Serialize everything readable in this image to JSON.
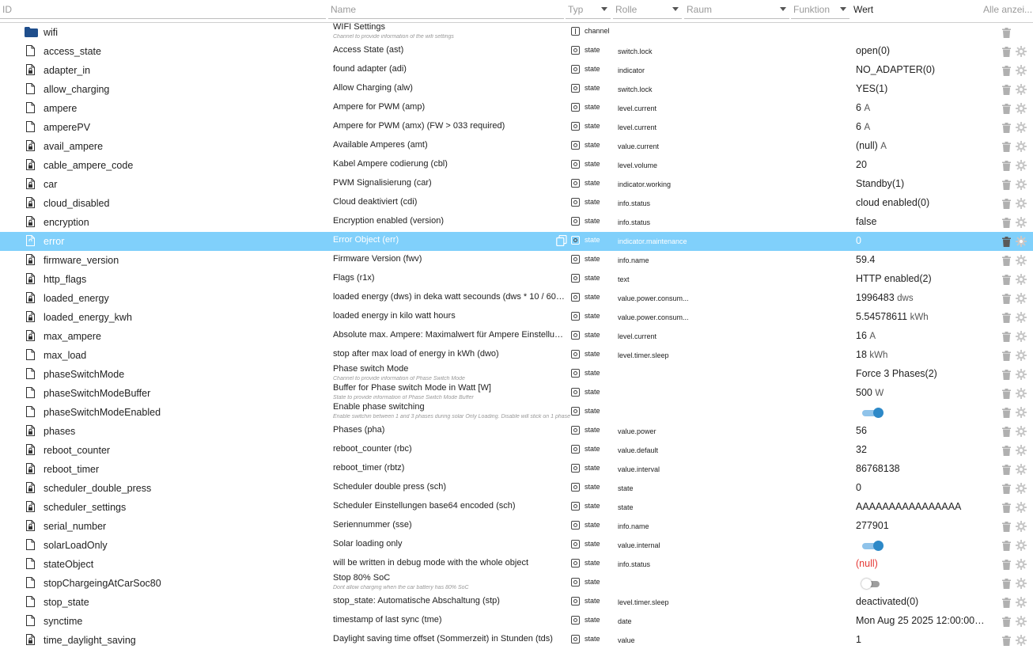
{
  "header": {
    "id": "ID",
    "name": "Name",
    "typ": "Typ",
    "rolle": "Rolle",
    "raum": "Raum",
    "funktion": "Funktion",
    "wert": "Wert",
    "alle": "Alle anzei..."
  },
  "rows": [
    {
      "id": "wifi",
      "kind": "folder",
      "name": "WIFI Settings",
      "desc": "Channel to provide information of the wifi settings",
      "type": "channel",
      "role": "",
      "value": ""
    },
    {
      "id": "access_state",
      "kind": "file",
      "name": "Access State (ast)",
      "type": "state",
      "role": "switch.lock",
      "value": "open(0)"
    },
    {
      "id": "adapter_in",
      "kind": "file-lock",
      "name": "found adapter (adi)",
      "type": "state",
      "role": "indicator",
      "value": "NO_ADAPTER(0)"
    },
    {
      "id": "allow_charging",
      "kind": "file",
      "name": "Allow Charging (alw)",
      "type": "state",
      "role": "switch.lock",
      "value": "YES(1)"
    },
    {
      "id": "ampere",
      "kind": "file",
      "name": "Ampere for PWM (amp)",
      "type": "state",
      "role": "level.current",
      "value": "6",
      "unit": "A"
    },
    {
      "id": "amperePV",
      "kind": "file",
      "name": "Ampere for PWM (amx) (FW > 033 required)",
      "type": "state",
      "role": "level.current",
      "value": "6",
      "unit": "A"
    },
    {
      "id": "avail_ampere",
      "kind": "file-lock",
      "name": "Available Amperes (amt)",
      "type": "state",
      "role": "value.current",
      "value": "(null)",
      "unit": "A"
    },
    {
      "id": "cable_ampere_code",
      "kind": "file-lock",
      "name": "Kabel Ampere codierung (cbl)",
      "type": "state",
      "role": "level.volume",
      "value": "20"
    },
    {
      "id": "car",
      "kind": "file-lock",
      "name": "PWM Signalisierung (car)",
      "type": "state",
      "role": "indicator.working",
      "value": "Standby(1)"
    },
    {
      "id": "cloud_disabled",
      "kind": "file-lock",
      "name": "Cloud deaktiviert (cdi)",
      "type": "state",
      "role": "info.status",
      "value": "cloud enabled(0)"
    },
    {
      "id": "encryption",
      "kind": "file-lock",
      "name": "Encryption enabled (version)",
      "type": "state",
      "role": "info.status",
      "value": "false"
    },
    {
      "id": "error",
      "kind": "file-lock",
      "name": "Error Object (err)",
      "type": "state",
      "role": "indicator.maintenance",
      "value": "0",
      "selected": true
    },
    {
      "id": "firmware_version",
      "kind": "file-lock",
      "name": "Firmware Version (fwv)",
      "type": "state",
      "role": "info.name",
      "value": "59.4"
    },
    {
      "id": "http_flags",
      "kind": "file-lock",
      "name": "Flags (r1x)",
      "type": "state",
      "role": "text",
      "value": "HTTP enabled(2)"
    },
    {
      "id": "loaded_energy",
      "kind": "file-lock",
      "name": "loaded energy (dws) in deka watt secounds (dws * 10 / 60 / 60 ...",
      "type": "state",
      "role": "value.power.consum...",
      "value": "1996483",
      "unit": "dws"
    },
    {
      "id": "loaded_energy_kwh",
      "kind": "file-lock",
      "name": "loaded energy in kilo watt hours",
      "type": "state",
      "role": "value.power.consum...",
      "value": "5.54578611",
      "unit": "kWh"
    },
    {
      "id": "max_ampere",
      "kind": "file-lock",
      "name": "Absolute max. Ampere: Maximalwert für Ampere Einstellung (a...",
      "type": "state",
      "role": "level.current",
      "value": "16",
      "unit": "A"
    },
    {
      "id": "max_load",
      "kind": "file",
      "name": "stop after max load of energy in kWh (dwo)",
      "type": "state",
      "role": "level.timer.sleep",
      "value": "18",
      "unit": "kWh"
    },
    {
      "id": "phaseSwitchMode",
      "kind": "file",
      "name": "Phase switch Mode",
      "desc": "Channel to provide information of Phase Switch Mode",
      "type": "state",
      "role": "",
      "value": "Force 3 Phases(2)"
    },
    {
      "id": "phaseSwitchModeBuffer",
      "kind": "file",
      "name": "Buffer for Phase switch Mode in Watt [W]",
      "desc": "State to provide information of Phase Switch Mode Buffer",
      "type": "state",
      "role": "",
      "value": "500",
      "unit": "W"
    },
    {
      "id": "phaseSwitchModeEnabled",
      "kind": "file",
      "name": "Enable phase switching",
      "desc": "Enable switchin between 1 and 3 phases during solar Only Loading. Disable will stick on 1 phase",
      "type": "state",
      "role": "",
      "toggle": "on"
    },
    {
      "id": "phases",
      "kind": "file-lock",
      "name": "Phases (pha)",
      "type": "state",
      "role": "value.power",
      "value": "56"
    },
    {
      "id": "reboot_counter",
      "kind": "file-lock",
      "name": "reboot_counter (rbc)",
      "type": "state",
      "role": "value.default",
      "value": "32"
    },
    {
      "id": "reboot_timer",
      "kind": "file-lock",
      "name": "reboot_timer (rbtz)",
      "type": "state",
      "role": "value.interval",
      "value": "86768138"
    },
    {
      "id": "scheduler_double_press",
      "kind": "file-lock",
      "name": "Scheduler double press (sch)",
      "type": "state",
      "role": "state",
      "value": "0"
    },
    {
      "id": "scheduler_settings",
      "kind": "file-lock",
      "name": "Scheduler Einstellungen base64 encoded (sch)",
      "type": "state",
      "role": "state",
      "value": "AAAAAAAAAAAAAAAA"
    },
    {
      "id": "serial_number",
      "kind": "file-lock",
      "name": "Seriennummer (sse)",
      "type": "state",
      "role": "info.name",
      "value": "277901"
    },
    {
      "id": "solarLoadOnly",
      "kind": "file",
      "name": "Solar loading only",
      "type": "state",
      "role": "value.internal",
      "toggle": "on"
    },
    {
      "id": "stateObject",
      "kind": "file",
      "name": "will be written in debug mode with the whole object",
      "type": "state",
      "role": "info.status",
      "value": "(null)",
      "isnull": true
    },
    {
      "id": "stopChargeingAtCarSoc80",
      "kind": "file",
      "name": "Stop 80% SoC",
      "desc": "Dont allow charging when the car battery has 80% SoC",
      "type": "state",
      "role": "",
      "toggle": "off"
    },
    {
      "id": "stop_state",
      "kind": "file",
      "name": "stop_state: Automatische Abschaltung (stp)",
      "type": "state",
      "role": "level.timer.sleep",
      "value": "deactivated(0)"
    },
    {
      "id": "synctime",
      "kind": "file",
      "name": "timestamp of last sync (tme)",
      "type": "state",
      "role": "date",
      "value": "Mon Aug 25 2025 12:00:00 G..."
    },
    {
      "id": "time_daylight_saving",
      "kind": "file-lock",
      "name": "Daylight saving time offset (Sommerzeit) in Stunden (tds)",
      "type": "state",
      "role": "value",
      "value": "1"
    }
  ]
}
